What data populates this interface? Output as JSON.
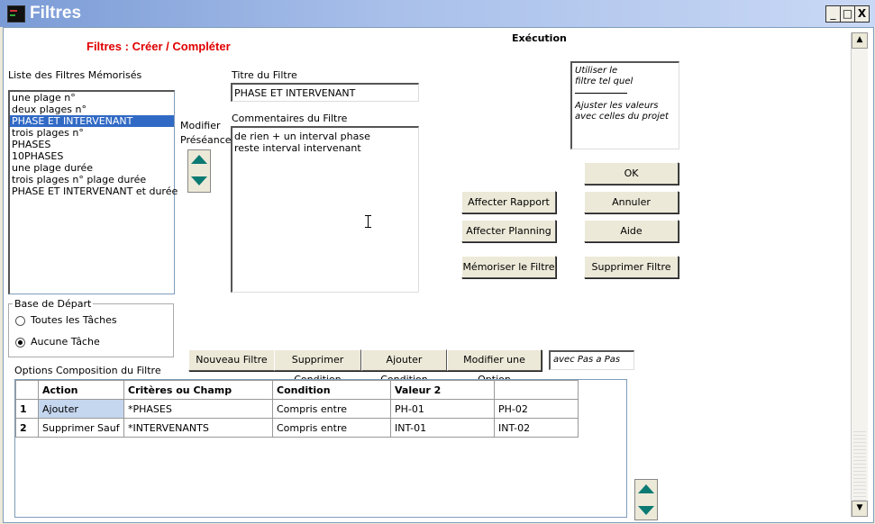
{
  "window": {
    "title": "Filtres",
    "min": "_",
    "max": "□",
    "close": "X"
  },
  "heading": "Filtres : Créer / Compléter",
  "execution": {
    "label": "Exécution",
    "note_line1": "Utiliser le",
    "note_line2": "filtre tel quel",
    "note_line3": "Ajuster les valeurs",
    "note_line4": "avec celles du projet"
  },
  "stored_filters": {
    "label": "Liste des Filtres Mémorisés",
    "items": [
      "une plage n°",
      "deux plages n°",
      "PHASE ET INTERVENANT",
      "trois plages n°",
      "PHASES",
      "10PHASES",
      "une  plage durée",
      "trois plages n° plage durée",
      "PHASE ET INTERVENANT et durée"
    ],
    "selected_index": 2
  },
  "modify": {
    "line1": "Modifier",
    "line2": "Préséance"
  },
  "filter_title": {
    "label": "Titre du Filtre",
    "value": "PHASE ET INTERVENANT"
  },
  "filter_comment": {
    "label": "Commentaires du Filtre",
    "line1": "de rien + un interval phase",
    "line2": "reste interval intervenant"
  },
  "buttons": {
    "ok": "OK",
    "cancel": "Annuler",
    "help": "Aide",
    "delete_filter": "Supprimer Filtre",
    "assign_report": "Affecter Rapport",
    "assign_planning": "Affecter Planning",
    "save_filter": "Mémoriser le Filtre",
    "new_filter": "Nouveau Filtre",
    "delete_condition": "Supprimer Condition",
    "add_condition": "Ajouter Condition",
    "modify_option": "Modifier une Option"
  },
  "step_field": "avec Pas a Pas",
  "base": {
    "label": "Base de Départ",
    "option1": "Toutes les Tâches",
    "option2": "Aucune Tâche",
    "selected": 2
  },
  "options": {
    "label": "Options Composition du Filtre",
    "headers": [
      "",
      "Action",
      "Critères ou Champ",
      "Condition",
      "Valeur 2",
      ""
    ],
    "rows": [
      [
        "1",
        "Ajouter",
        "*PHASES",
        "Compris entre",
        "PH-01",
        "PH-02"
      ],
      [
        "2",
        "Supprimer Sauf",
        "*INTERVENANTS",
        "Compris entre",
        "INT-01",
        "INT-02"
      ]
    ]
  },
  "colors": {
    "heading": "#e00000",
    "selection": "#316ac5",
    "arrows": "#0b7a73"
  }
}
